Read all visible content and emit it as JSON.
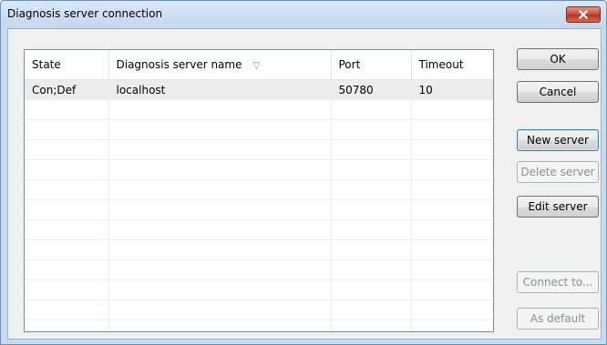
{
  "window": {
    "title": "Diagnosis server connection"
  },
  "list": {
    "columns": [
      {
        "label": "State"
      },
      {
        "label": "Diagnosis server name",
        "sort": "▽"
      },
      {
        "label": "Port"
      },
      {
        "label": "Timeout"
      }
    ],
    "rows": [
      {
        "state": "Con;Def",
        "name": "localhost",
        "port": "50780",
        "timeout": "10"
      }
    ]
  },
  "buttons": {
    "ok": "OK",
    "cancel": "Cancel",
    "new_server": "New server",
    "delete_server": "Delete server",
    "edit_server": "Edit server",
    "connect_to": "Connect to...",
    "as_default": "As default"
  },
  "colors": {
    "titlebar": "#c3d7ee",
    "close_button": "#c9483a",
    "selected_row": "#ececec"
  }
}
